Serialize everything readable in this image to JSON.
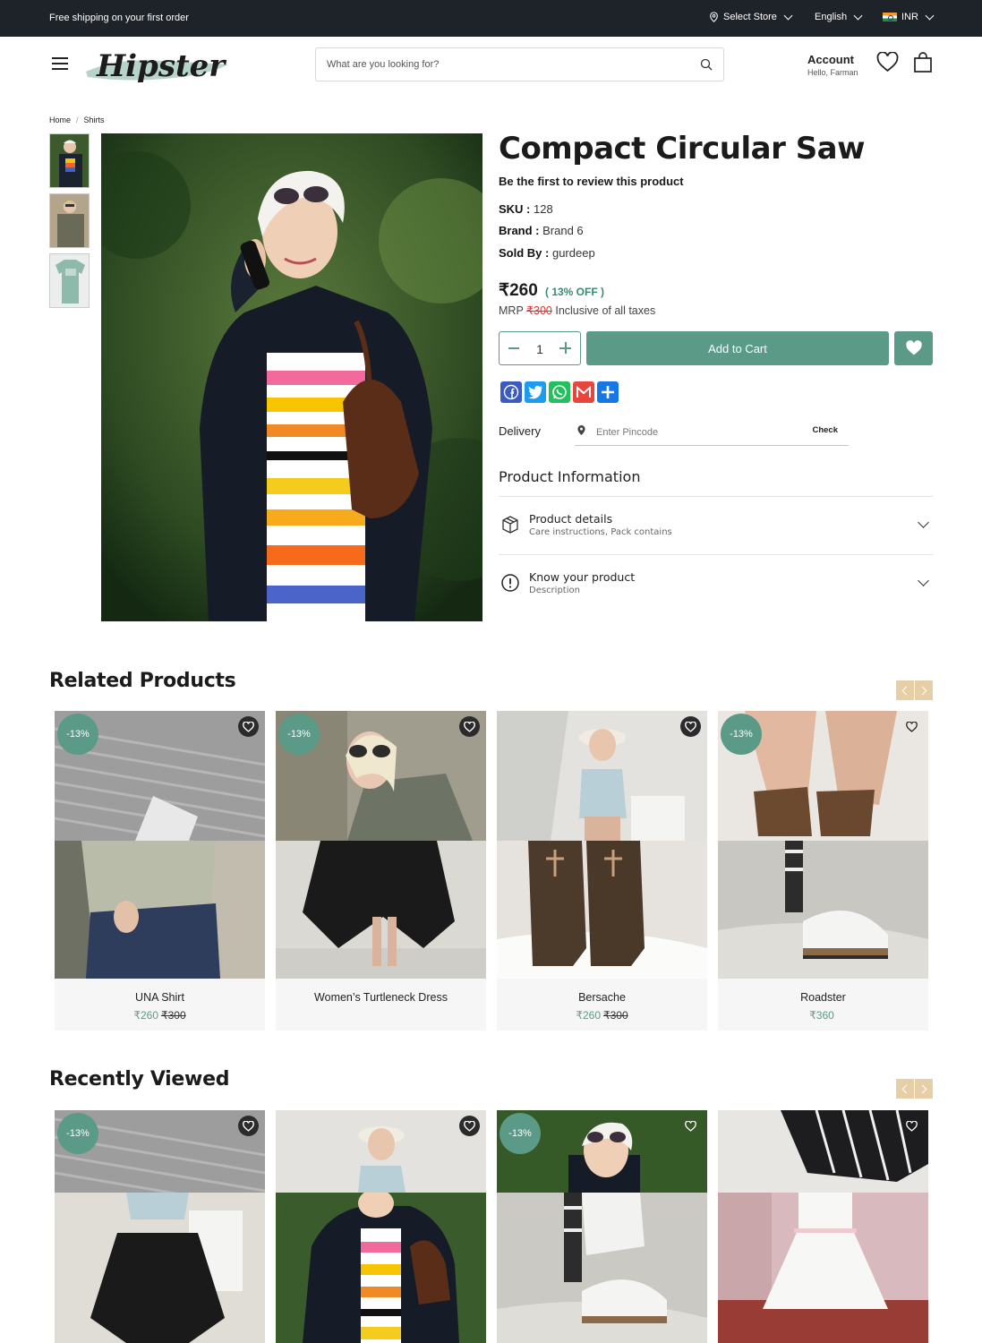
{
  "topbar": {
    "promo": "Free shipping on your first order",
    "store": "Select Store",
    "language": "English",
    "currency": "INR"
  },
  "header": {
    "logo_text": "Hipster",
    "search_placeholder": "What are you looking for?",
    "account_label": "Account",
    "account_greeting": "Hello, Farman"
  },
  "breadcrumb": [
    "Home",
    "/",
    "Shirts"
  ],
  "product": {
    "title": "Compact Circular Saw",
    "review_cta": "Be the first to review this product",
    "sku_label": "SKU :",
    "sku": "128",
    "brand_label": "Brand :",
    "brand": "Brand 6",
    "sold_label": "Sold By :",
    "seller": "gurdeep",
    "price": "₹260",
    "discount": "( 13% OFF )",
    "mrp_label": "MRP",
    "mrp": "₹300",
    "tax_note": "Inclusive of all taxes",
    "quantity": "1",
    "add_to_cart": "Add to Cart"
  },
  "delivery": {
    "label": "Delivery",
    "placeholder": "Enter Pincode",
    "check": "Check"
  },
  "product_information": {
    "title": "Product Information",
    "sections": [
      {
        "title": "Product details",
        "subtitle": "Care instructions, Pack contains",
        "icon": "box-icon"
      },
      {
        "title": "Know your product",
        "subtitle": "Description",
        "icon": "info-icon"
      }
    ]
  },
  "related": {
    "title": "Related Products",
    "items": [
      {
        "name": "UNA Shirt",
        "price": "₹260",
        "old_price": "₹300",
        "badge": "-13%"
      },
      {
        "name": "Women’s Turtleneck Dress",
        "price": "",
        "old_price": "",
        "badge": "-13%"
      },
      {
        "name": "Bersache",
        "price": "₹260",
        "old_price": "₹300",
        "badge": ""
      },
      {
        "name": "Roadster",
        "price": "₹360",
        "old_price": "",
        "badge": "-13%"
      }
    ]
  },
  "recent": {
    "title": "Recently Viewed",
    "items": [
      {
        "badge": "-13%"
      },
      {
        "badge": ""
      },
      {
        "badge": "-13%"
      },
      {
        "badge": ""
      }
    ]
  },
  "colors": {
    "accent": "#5a9a87",
    "topbar": "#1e2229",
    "arrow": "#e6cfa6",
    "strike": "#dd3333"
  }
}
